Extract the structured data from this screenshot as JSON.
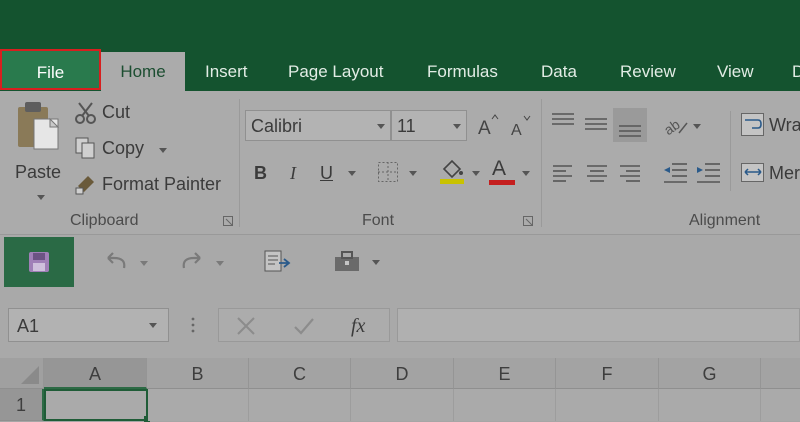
{
  "tabs": [
    "File",
    "Home",
    "Insert",
    "Page Layout",
    "Formulas",
    "Data",
    "Review",
    "View",
    "D"
  ],
  "clipboard": {
    "paste_label": "Paste",
    "cut_label": "Cut",
    "copy_label": "Copy",
    "format_painter_label": "Format Painter",
    "group_label": "Clipboard"
  },
  "font": {
    "font_name": "Calibri",
    "font_size": "11",
    "bold": "B",
    "italic": "I",
    "underline": "U",
    "font_color_glyph": "A",
    "group_label": "Font",
    "highlight_color": "#c9c200",
    "font_color": "#c41e1e"
  },
  "alignment": {
    "wrap_label": "Wra",
    "merge_label": "Mer",
    "group_label": "Alignment"
  },
  "formula_bar": {
    "name_box": "A1",
    "fx_label": "fx",
    "formula_value": ""
  },
  "grid": {
    "columns": [
      "A",
      "B",
      "C",
      "D",
      "E",
      "F",
      "G"
    ],
    "rows": [
      "1"
    ]
  },
  "colors": {
    "title_bar": "#14532f",
    "file_tab": "#297a4d",
    "highlight_border": "#d81f1f"
  }
}
